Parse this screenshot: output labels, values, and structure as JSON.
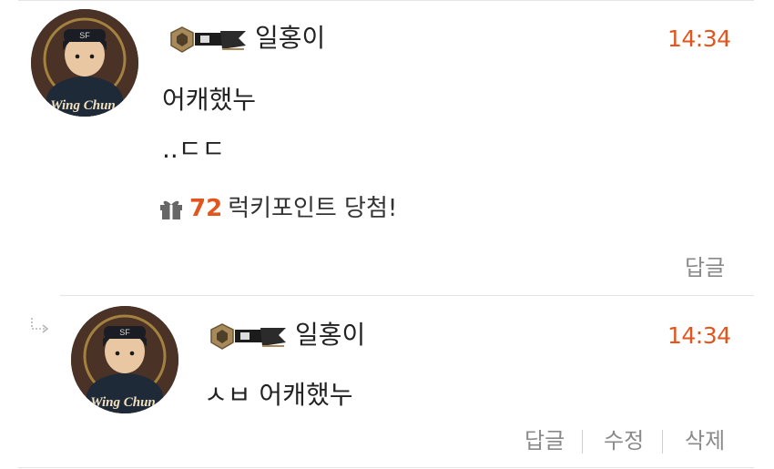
{
  "comments": [
    {
      "username": "일홍이",
      "time": "14:34",
      "lines": [
        "어캐했누",
        "..ㄷㄷ"
      ],
      "lucky": {
        "points": "72",
        "text": "럭키포인트 당첨!"
      },
      "actions": {
        "reply": "답글"
      }
    },
    {
      "username": "일홍이",
      "time": "14:34",
      "lines": [
        "ㅅㅂ 어캐했누"
      ],
      "actions": {
        "reply": "답글",
        "edit": "수정",
        "delete": "삭제"
      }
    }
  ],
  "avatar": {
    "caption": "Wing Chun",
    "cap_text": "SF"
  },
  "icons": {
    "gift": "gift-icon",
    "reply_arrow": "reply-arrow-icon",
    "rank_badge": "rank-badge-icon"
  },
  "colors": {
    "accent": "#e0561e",
    "muted": "#8a8a8a"
  }
}
